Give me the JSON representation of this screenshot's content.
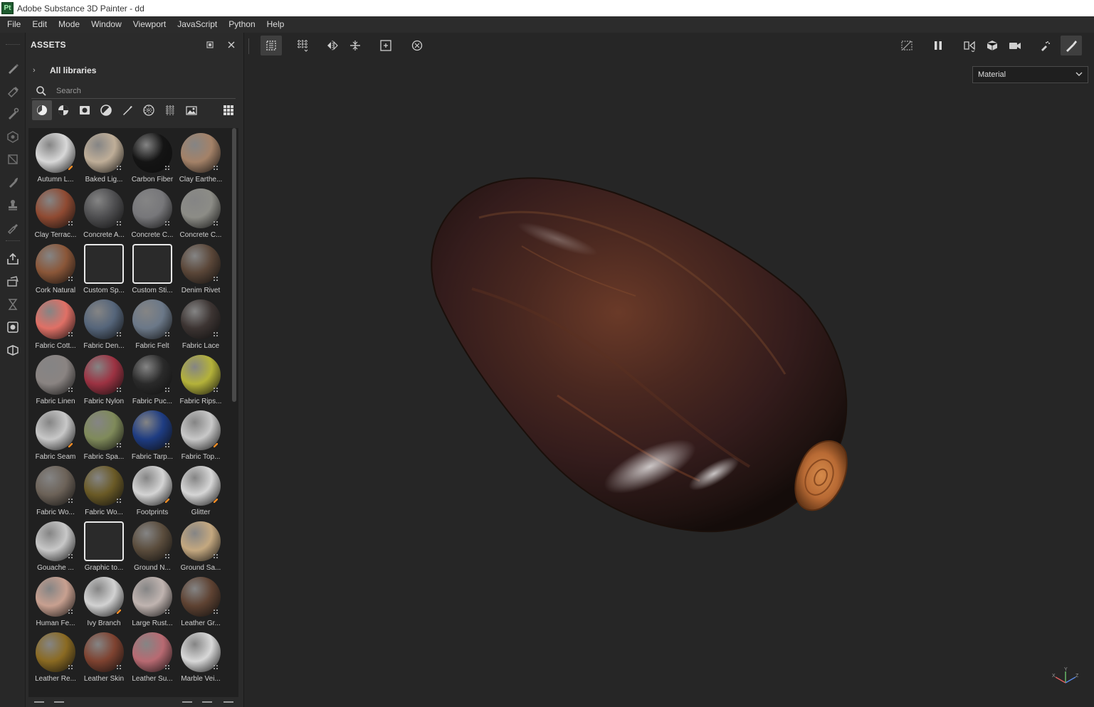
{
  "window": {
    "title": "Adobe Substance 3D Painter - dd",
    "logo_text": "Pt"
  },
  "menu": [
    "File",
    "Edit",
    "Mode",
    "Window",
    "Viewport",
    "JavaScript",
    "Python",
    "Help"
  ],
  "assets_panel": {
    "title": "ASSETS",
    "libraries_label": "All libraries",
    "search_placeholder": "Search",
    "filters": [
      "smart-material-icon",
      "material-icon",
      "mask-icon",
      "smart-mask-icon",
      "brush-icon",
      "alpha-icon",
      "texture-icon",
      "environment-icon",
      "grid-view-icon"
    ],
    "active_filter": "smart-material-icon",
    "items": [
      {
        "label": "Autumn L...",
        "color": "#d8d8d8",
        "badge": "brush"
      },
      {
        "label": "Baked Lig...",
        "color": "#bfae98",
        "badge": "dots"
      },
      {
        "label": "Carbon Fiber",
        "color": "#141414",
        "badge": "dots"
      },
      {
        "label": "Clay Earthe...",
        "color": "#a48268",
        "badge": "dots"
      },
      {
        "label": "Clay Terrac...",
        "color": "#8f4a32",
        "badge": "dots"
      },
      {
        "label": "Concrete A...",
        "color": "#4e4e50",
        "badge": "dots"
      },
      {
        "label": "Concrete C...",
        "color": "#77777a",
        "badge": "dots"
      },
      {
        "label": "Concrete C...",
        "color": "#8c8c86",
        "badge": "dots"
      },
      {
        "label": "Cork Natural",
        "color": "#8a5638",
        "badge": "dots"
      },
      {
        "label": "Custom Sp...",
        "color": "#e8e8e8",
        "badge": "none"
      },
      {
        "label": "Custom Sti...",
        "color": "#e8e8e8",
        "badge": "none"
      },
      {
        "label": "Denim Rivet",
        "color": "#5a4638",
        "badge": "dots"
      },
      {
        "label": "Fabric Cott...",
        "color": "#e07066",
        "badge": "dots"
      },
      {
        "label": "Fabric Den...",
        "color": "#55657a",
        "badge": "dots"
      },
      {
        "label": "Fabric Felt",
        "color": "#6b7888",
        "badge": "dots"
      },
      {
        "label": "Fabric Lace",
        "color": "#3c3432",
        "badge": "dots"
      },
      {
        "label": "Fabric Linen",
        "color": "#8a8482",
        "badge": "dots"
      },
      {
        "label": "Fabric Nylon",
        "color": "#9c3242",
        "badge": "dots"
      },
      {
        "label": "Fabric Puc...",
        "color": "#2a2a2a",
        "badge": "dots"
      },
      {
        "label": "Fabric Rips...",
        "color": "#b4b23a",
        "badge": "dots"
      },
      {
        "label": "Fabric Seam",
        "color": "#c8c8c8",
        "badge": "brush"
      },
      {
        "label": "Fabric Spa...",
        "color": "#7f8a5a",
        "badge": "dots"
      },
      {
        "label": "Fabric Tarp...",
        "color": "#1e3c82",
        "badge": "dots"
      },
      {
        "label": "Fabric Top...",
        "color": "#c8c8c8",
        "badge": "brush"
      },
      {
        "label": "Fabric Wo...",
        "color": "#6c6258",
        "badge": "dots"
      },
      {
        "label": "Fabric Wo...",
        "color": "#6a5a26",
        "badge": "dots"
      },
      {
        "label": "Footprints",
        "color": "#d4d4d4",
        "badge": "brush"
      },
      {
        "label": "Glitter",
        "color": "#d6d6d6",
        "badge": "brush"
      },
      {
        "label": "Gouache ...",
        "color": "#c8c8c8",
        "badge": "dots"
      },
      {
        "label": "Graphic to...",
        "color": "#e8e8e8",
        "badge": "none"
      },
      {
        "label": "Ground N...",
        "color": "#5a4c3c",
        "badge": "dots"
      },
      {
        "label": "Ground Sa...",
        "color": "#c4a880",
        "badge": "dots"
      },
      {
        "label": "Human Fe...",
        "color": "#c8a090",
        "badge": "dots"
      },
      {
        "label": "Ivy Branch",
        "color": "#d2d2d2",
        "badge": "brush"
      },
      {
        "label": "Large Rust...",
        "color": "#c0b4b0",
        "badge": "dots"
      },
      {
        "label": "Leather Gr...",
        "color": "#5e4232",
        "badge": "dots"
      },
      {
        "label": "Leather Re...",
        "color": "#8a6a22",
        "badge": "dots"
      },
      {
        "label": "Leather Skin",
        "color": "#7e4230",
        "badge": "dots"
      },
      {
        "label": "Leather Su...",
        "color": "#b86a72",
        "badge": "dots"
      },
      {
        "label": "Marble Vei...",
        "color": "#d8d8d8",
        "badge": "dots"
      }
    ]
  },
  "viewport": {
    "channel_select": "Material",
    "axis_labels": {
      "x": "X",
      "y": "Y",
      "z": "Z"
    }
  }
}
